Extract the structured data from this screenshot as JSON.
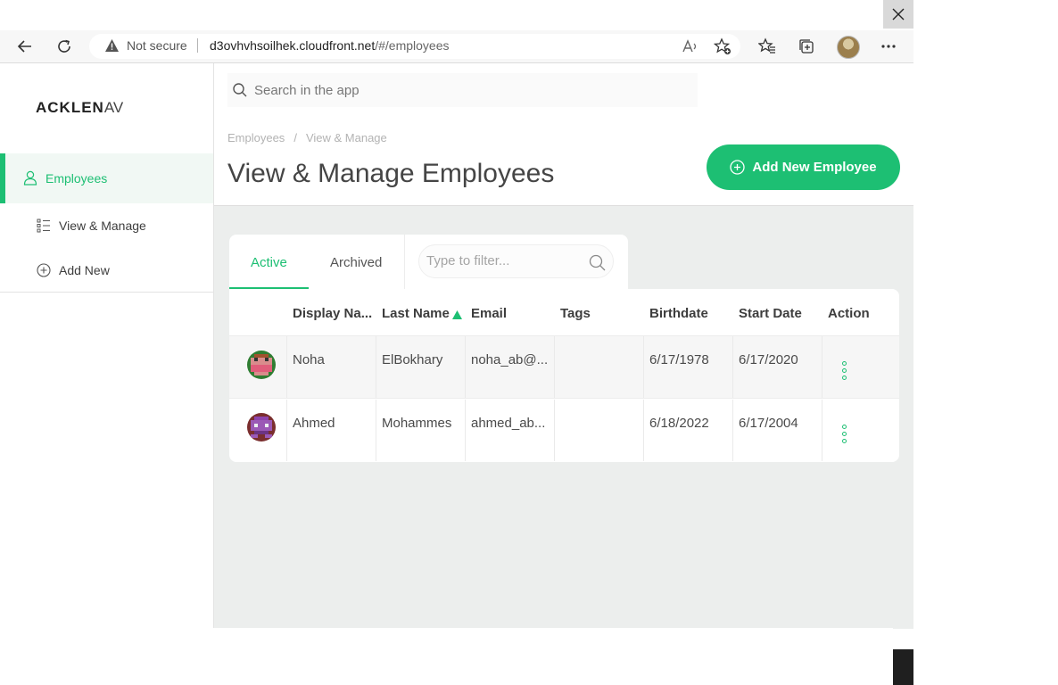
{
  "browser": {
    "security_label": "Not secure",
    "url_host": "d3ovhvhsoilhek.cloudfront.net",
    "url_path": "/#/employees"
  },
  "sidebar": {
    "logo_main": "ACKLEN",
    "logo_tail": "AV",
    "items": [
      {
        "label": "Employees",
        "icon": "user-icon",
        "active": true
      },
      {
        "label": "View & Manage",
        "icon": "list-icon",
        "active": false
      },
      {
        "label": "Add New",
        "icon": "plus-circle-icon",
        "active": false
      }
    ]
  },
  "header": {
    "search_placeholder": "Search in the app",
    "breadcrumb": [
      "Employees",
      "View & Manage"
    ],
    "title": "View & Manage Employees",
    "add_button": "Add New Employee"
  },
  "tabs": {
    "items": [
      "Active",
      "Archived"
    ],
    "active": "Active",
    "filter_placeholder": "Type to filter..."
  },
  "table": {
    "columns": [
      "Display Na...",
      "Last Name",
      "Email",
      "Tags",
      "Birthdate",
      "Start Date",
      "Action"
    ],
    "sorted_column": "Last Name",
    "sort_direction": "ascending",
    "rows": [
      {
        "display_name": "Noha",
        "last_name": "ElBokhary",
        "email": "noha_ab@...",
        "tags": "",
        "birthdate": "6/17/1978",
        "start_date": "6/17/2020"
      },
      {
        "display_name": "Ahmed",
        "last_name": "Mohammes",
        "email": "ahmed_ab...",
        "tags": "",
        "birthdate": "6/18/2022",
        "start_date": "6/17/2004"
      }
    ]
  },
  "colors": {
    "accent": "#1dbf73",
    "content_bg": "#eceeed",
    "text": "#3d3d3d"
  }
}
